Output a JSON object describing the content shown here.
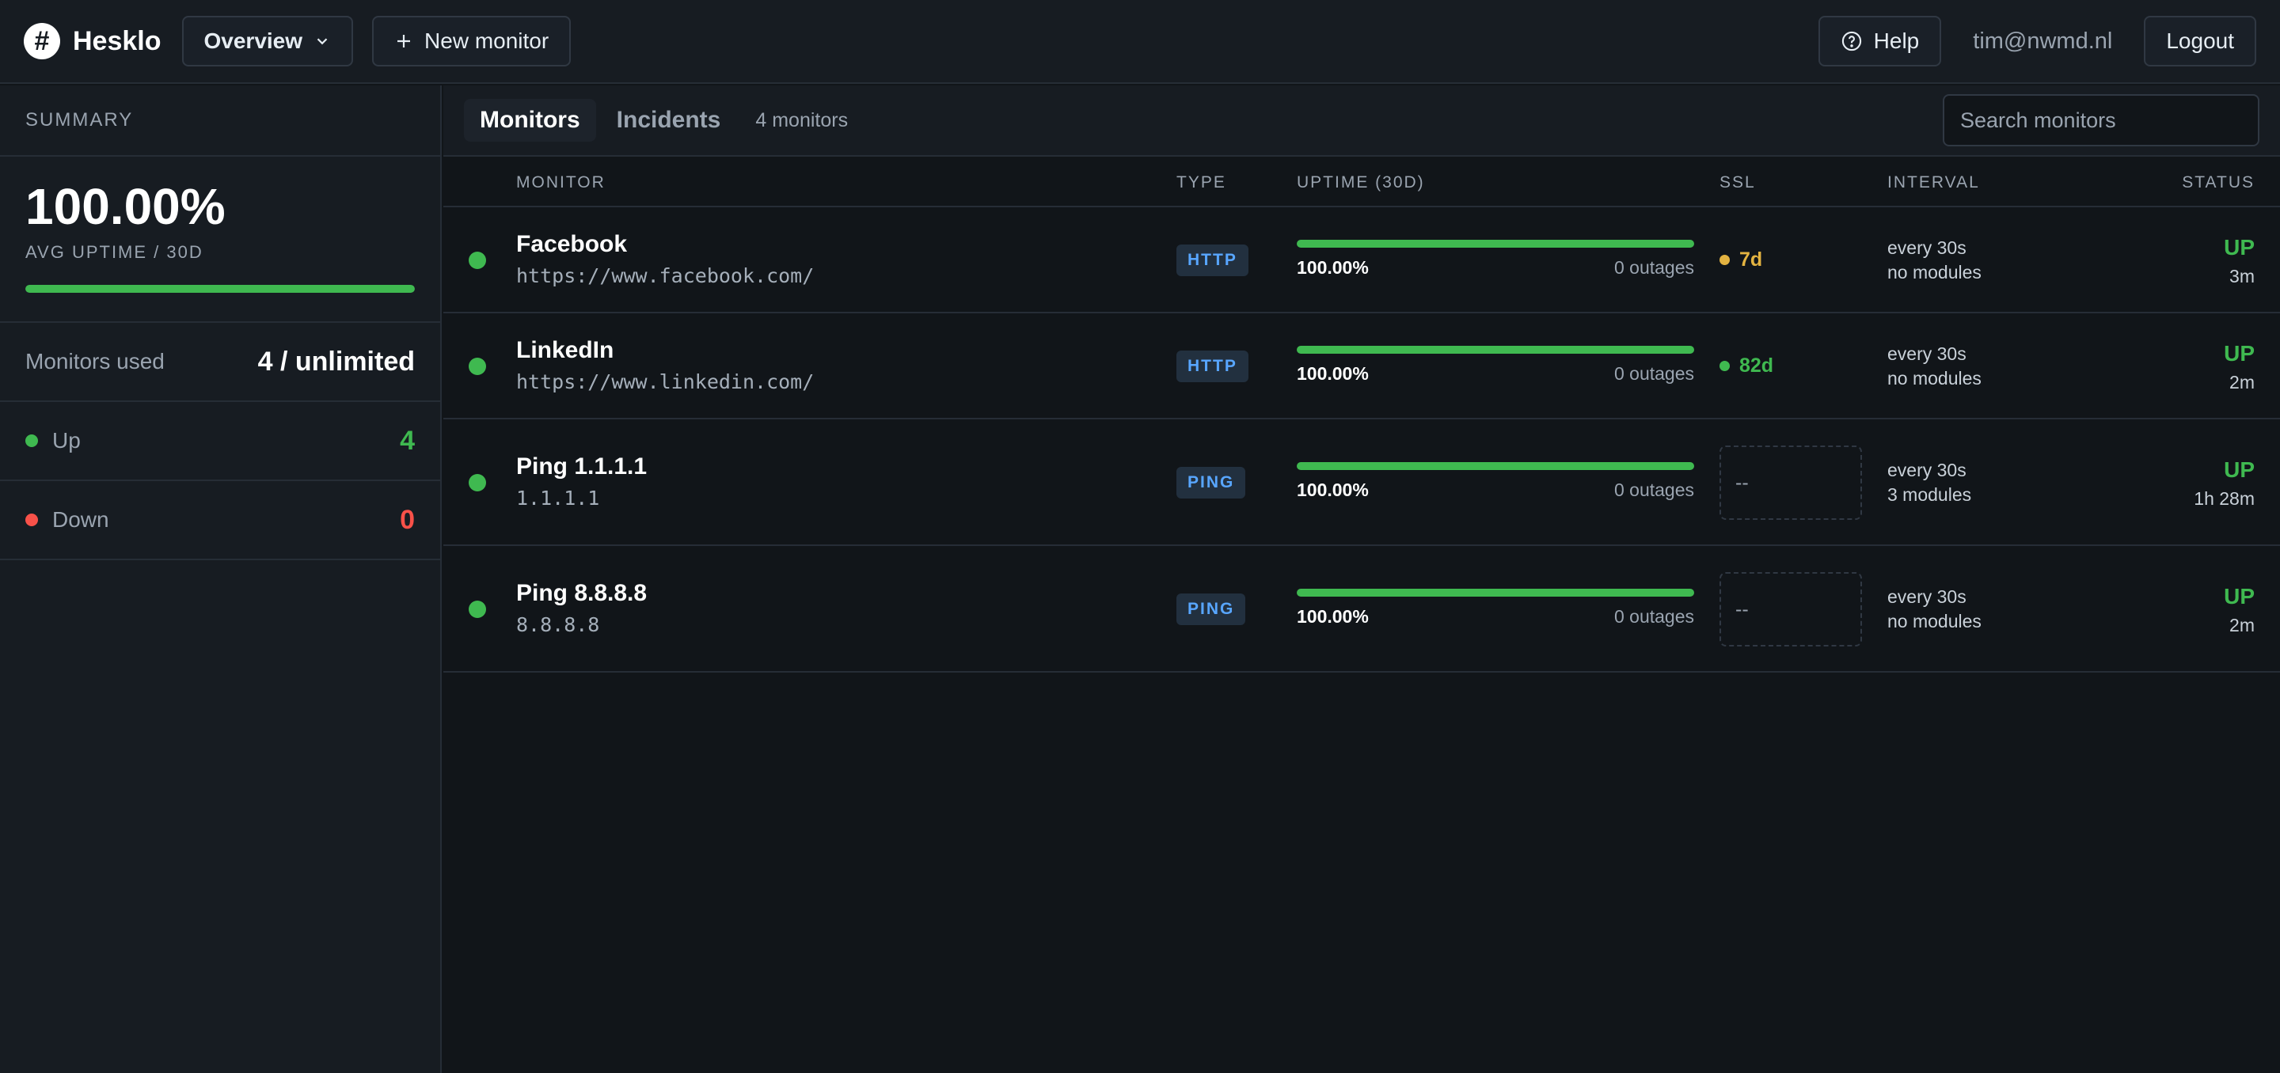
{
  "header": {
    "brand": "Hesklo",
    "logo_glyph": "#",
    "view_select": "Overview",
    "new_monitor": "New monitor",
    "help": "Help",
    "user_email": "tim@nwmd.nl",
    "logout": "Logout"
  },
  "sidebar": {
    "heading": "SUMMARY",
    "avg_uptime": "100.00%",
    "avg_uptime_label": "AVG UPTIME / 30D",
    "avg_uptime_fraction": 1.0,
    "monitors_used_label": "Monitors used",
    "monitors_used_value": "4 / unlimited",
    "up_label": "Up",
    "up_count": "4",
    "down_label": "Down",
    "down_count": "0"
  },
  "main": {
    "tabs": [
      "Monitors",
      "Incidents"
    ],
    "monitor_count": "4 monitors",
    "search_placeholder": "Search monitors",
    "columns": {
      "monitor": "MONITOR",
      "type": "TYPE",
      "uptime": "UPTIME (30D)",
      "ssl": "SSL",
      "interval": "INTERVAL",
      "status": "STATUS"
    },
    "rows": [
      {
        "name": "Facebook",
        "url": "https://www.facebook.com/",
        "type": "HTTP",
        "uptime": "100.00%",
        "outages": "0 outages",
        "ssl": "7d",
        "ssl_color": "#e3b341",
        "interval": "every 30s",
        "modules": "no modules",
        "status": "UP",
        "duration": "3m"
      },
      {
        "name": "LinkedIn",
        "url": "https://www.linkedin.com/",
        "type": "HTTP",
        "uptime": "100.00%",
        "outages": "0 outages",
        "ssl": "82d",
        "ssl_color": "#3fb950",
        "interval": "every 30s",
        "modules": "no modules",
        "status": "UP",
        "duration": "2m"
      },
      {
        "name": "Ping 1.1.1.1",
        "url": "1.1.1.1",
        "type": "PING",
        "uptime": "100.00%",
        "outages": "0 outages",
        "ssl": "--",
        "interval": "every 30s",
        "modules": "3 modules",
        "status": "UP",
        "duration": "1h 28m"
      },
      {
        "name": "Ping 8.8.8.8",
        "url": "8.8.8.8",
        "type": "PING",
        "uptime": "100.00%",
        "outages": "0 outages",
        "ssl": "--",
        "interval": "every 30s",
        "modules": "no modules",
        "status": "UP",
        "duration": "2m"
      }
    ]
  },
  "colors": {
    "accent_green": "#3fb950",
    "danger_red": "#f85149",
    "warning_amber": "#e3b341",
    "badge_blue": "#58a6ff"
  },
  "icons": [
    "hash-logo-icon",
    "chevron-down-icon",
    "plus-icon",
    "help-circle-icon",
    "status-dot-icon"
  ]
}
